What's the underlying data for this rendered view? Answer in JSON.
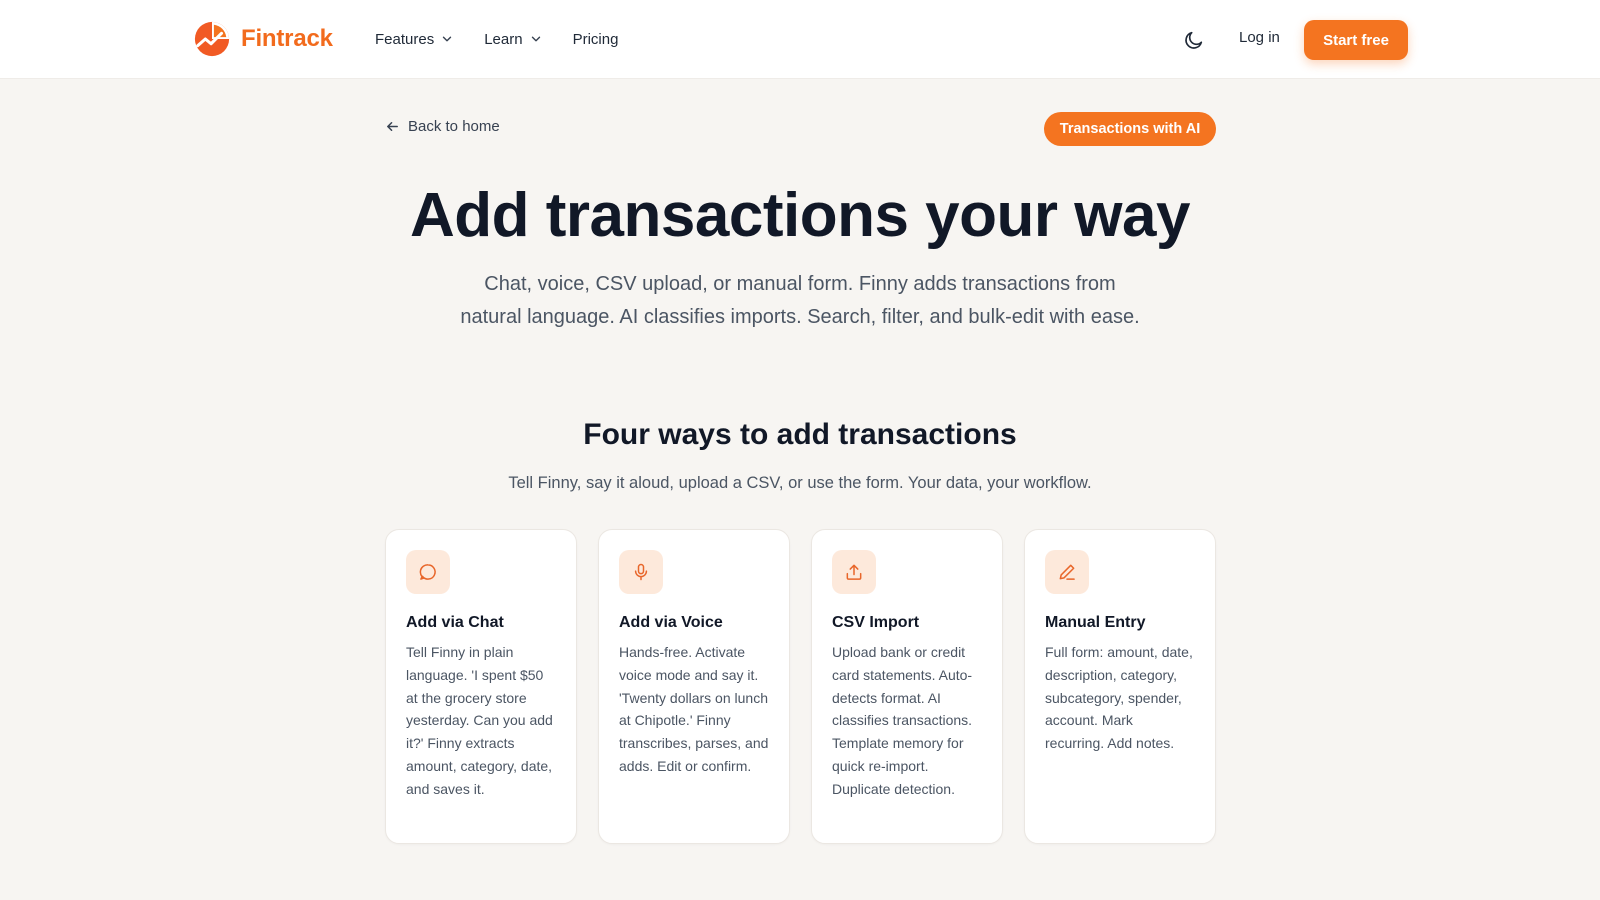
{
  "brand": {
    "name": "Fintrack",
    "accent": "#f47420"
  },
  "nav": {
    "items": [
      {
        "label": "Features",
        "has_dropdown": true
      },
      {
        "label": "Learn",
        "has_dropdown": true
      },
      {
        "label": "Pricing",
        "has_dropdown": false
      }
    ],
    "theme_icon": "moon-icon",
    "login_label": "Log in",
    "cta_label": "Start free"
  },
  "subheader": {
    "back_label": "Back to home",
    "badge": "Transactions with AI"
  },
  "hero": {
    "title": "Add transactions your way",
    "subtitle": "Chat, voice, CSV upload, or manual form. Finny adds transactions from natural language. AI classifies imports. Search, filter, and bulk-edit with ease."
  },
  "section": {
    "title": "Four ways to add transactions",
    "subtitle": "Tell Finny, say it aloud, upload a CSV, or use the form. Your data, your workflow."
  },
  "cards": [
    {
      "icon": "chat-icon",
      "title": "Add via Chat",
      "description": "Tell Finny in plain language. 'I spent $50 at the grocery store yesterday. Can you add it?' Finny extracts amount, category, date, and saves it."
    },
    {
      "icon": "microphone-icon",
      "title": "Add via Voice",
      "description": "Hands-free. Activate voice mode and say it. 'Twenty dollars on lunch at Chipotle.' Finny transcribes, parses, and adds. Edit or confirm."
    },
    {
      "icon": "upload-icon",
      "title": "CSV Import",
      "description": "Upload bank or credit card statements. Auto-detects format. AI classifies transactions. Template memory for quick re-import. Duplicate detection."
    },
    {
      "icon": "pencil-icon",
      "title": "Manual Entry",
      "description": "Full form: amount, date, description, category, subcategory, spender, account. Mark recurring. Add notes."
    }
  ]
}
